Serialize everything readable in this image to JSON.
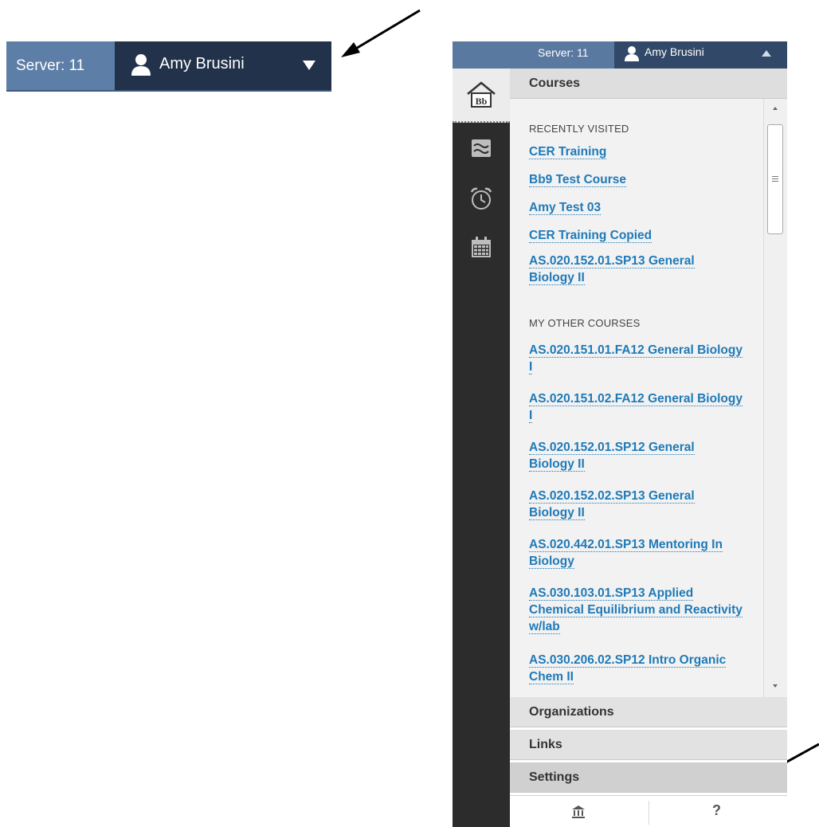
{
  "zoom_bar": {
    "server_label": "Server: 11",
    "user_name": "Amy Brusini",
    "icons": {
      "user": "user-icon",
      "caret": "caret-down-icon"
    }
  },
  "panel": {
    "top_bar": {
      "server_label": "Server: 11",
      "user_name": "Amy Brusini",
      "icons": {
        "user": "user-icon",
        "caret": "caret-up-icon"
      }
    },
    "rail_icons": [
      "blackboard-home-icon",
      "updates-icon",
      "alarm-clock-icon",
      "calendar-icon"
    ],
    "rail_home_label": "Bb",
    "sections": {
      "courses": "Courses",
      "organizations": "Organizations",
      "links": "Links",
      "settings": "Settings"
    },
    "recently_visited": {
      "label": "RECENTLY VISITED",
      "items": [
        "CER Training",
        "Bb9 Test Course",
        "Amy Test 03",
        "CER Training Copied",
        "AS.020.152.01.SP13 General Biology II"
      ]
    },
    "other_courses": {
      "label": "MY OTHER COURSES",
      "items": [
        "AS.020.151.01.FA12 General Biology I",
        "AS.020.151.02.FA12 General Biology I",
        "AS.020.152.01.SP12 General Biology II",
        "AS.020.152.02.SP13 General Biology II",
        "AS.020.442.01.SP13 Mentoring In Biology",
        "AS.030.103.01.SP13 Applied Chemical Equilibrium and Reactivity w/lab",
        "AS.030.206.02.SP12 Intro Organic Chem II"
      ]
    },
    "bottom": {
      "institution_icon": "institution-icon",
      "help_label": "?"
    }
  },
  "colors": {
    "header_blue": "#5d7ea6",
    "user_dark": "#22324a",
    "link_blue": "#1f7ab8",
    "rail_dark": "#2c2c2c",
    "arrow": "#000000"
  }
}
